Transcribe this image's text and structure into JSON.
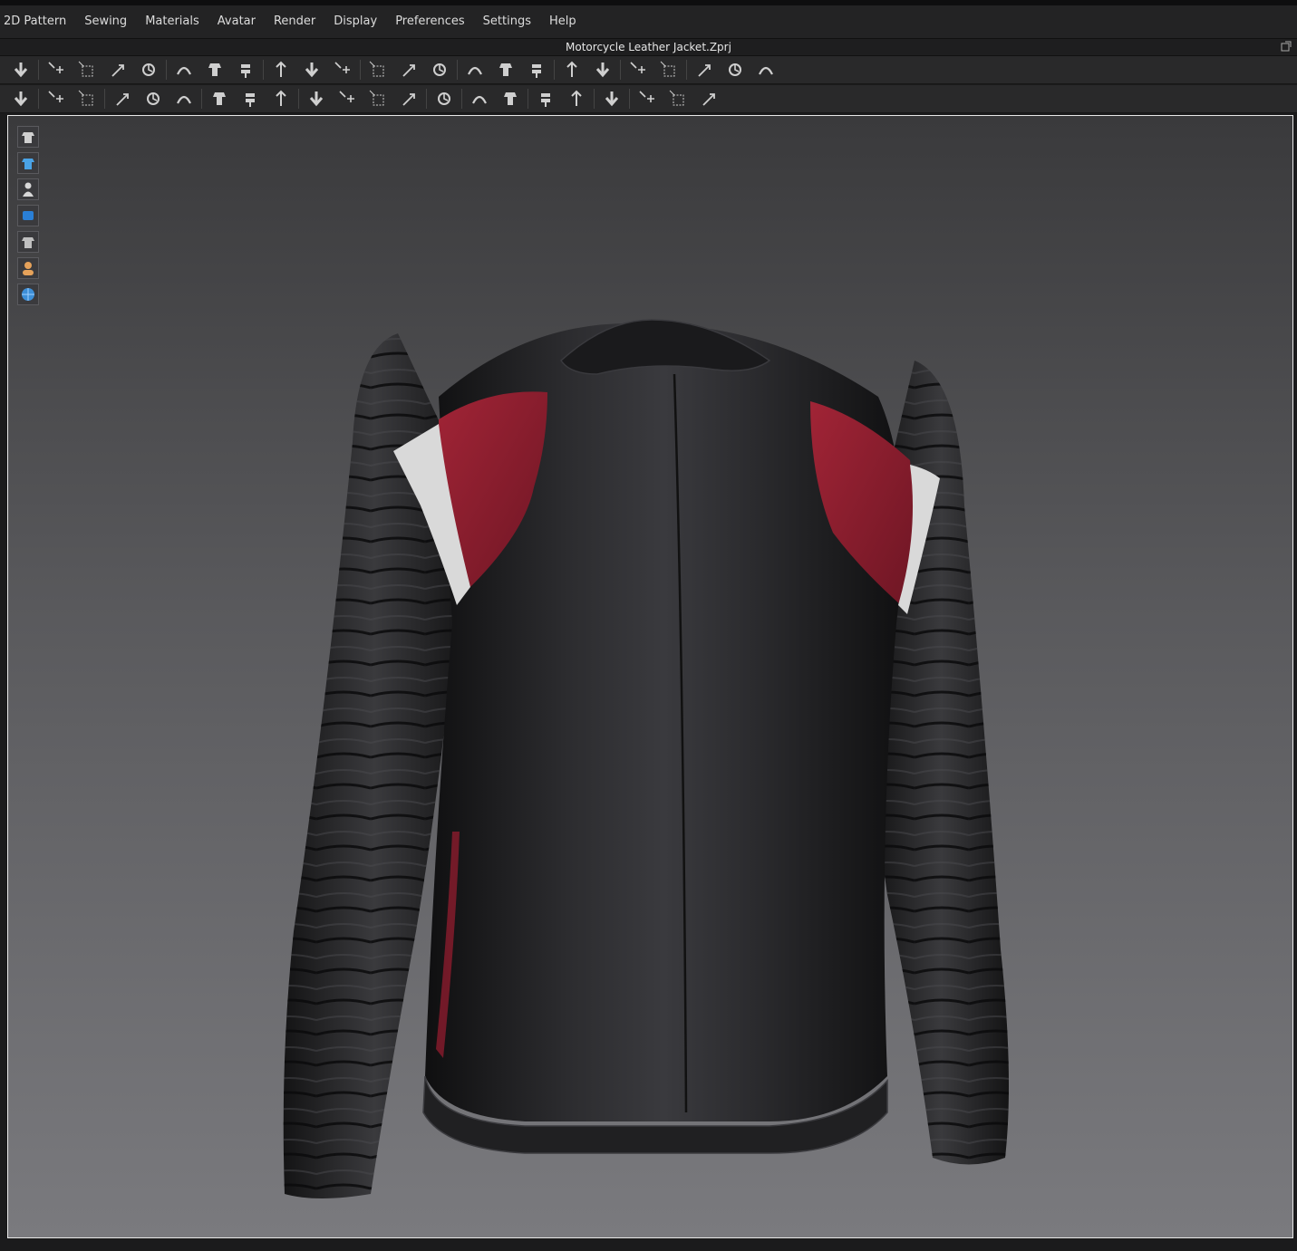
{
  "menu": {
    "items": [
      "2D Pattern",
      "Sewing",
      "Materials",
      "Avatar",
      "Render",
      "Display",
      "Preferences",
      "Settings",
      "Help"
    ]
  },
  "window": {
    "title": "Motorcycle Leather Jacket.Zprj"
  },
  "toolbar_row1": [
    "simulate-icon",
    "sep",
    "select-move-icon",
    "select-box-icon",
    "transform-icon",
    "edit-point-icon",
    "sep",
    "fold-arrange-icon",
    "fold-curve-icon",
    "fold-reset-icon",
    "sep",
    "pin-needle-icon",
    "tack-icon",
    "garment-pin-icon",
    "sep",
    "avatar-shirt-icon",
    "pants-icon",
    "body-icon",
    "sep",
    "arrangement-up-icon",
    "arrangement-down-icon",
    "arrangement-point-icon",
    "sep",
    "layer-clone-icon",
    "layer-stack-icon",
    "sep",
    "measure-height-icon",
    "measure-width-icon",
    "sep",
    "tape-curve-icon",
    "tape-loop-icon",
    "ruler-icon"
  ],
  "toolbar_row2": [
    "walk-motion-icon",
    "sep",
    "wind-icon",
    "strengthen-icon",
    "sep",
    "puckering-icon",
    "trim-line-icon",
    "fold-3d-icon",
    "sep",
    "texture-select-icon",
    "texture-scale-icon",
    "texture-pattern-icon",
    "sep",
    "button-add-icon",
    "button-icon",
    "buttonhole-icon",
    "button-fasten-icon",
    "sep",
    "zipper-icon",
    "sep",
    "topstitch-select-icon",
    "topstitch-icon",
    "sep",
    "piping-select-icon",
    "piping-icon",
    "sep",
    "measure-distance-icon",
    "sep",
    "garment-fit-icon",
    "garment-shirt-icon",
    "hat-icon"
  ],
  "side_toolbar": [
    "show-garment-icon",
    "show-avatar-icon",
    "avatar-pose-icon",
    "surface-icon",
    "fabric-icon",
    "skin-avatar-icon",
    "environment-globe-icon"
  ],
  "colors": {
    "leather": "#1c1c1e",
    "accent_red": "#8b1e2e",
    "accent_white": "#d8d8d8"
  }
}
